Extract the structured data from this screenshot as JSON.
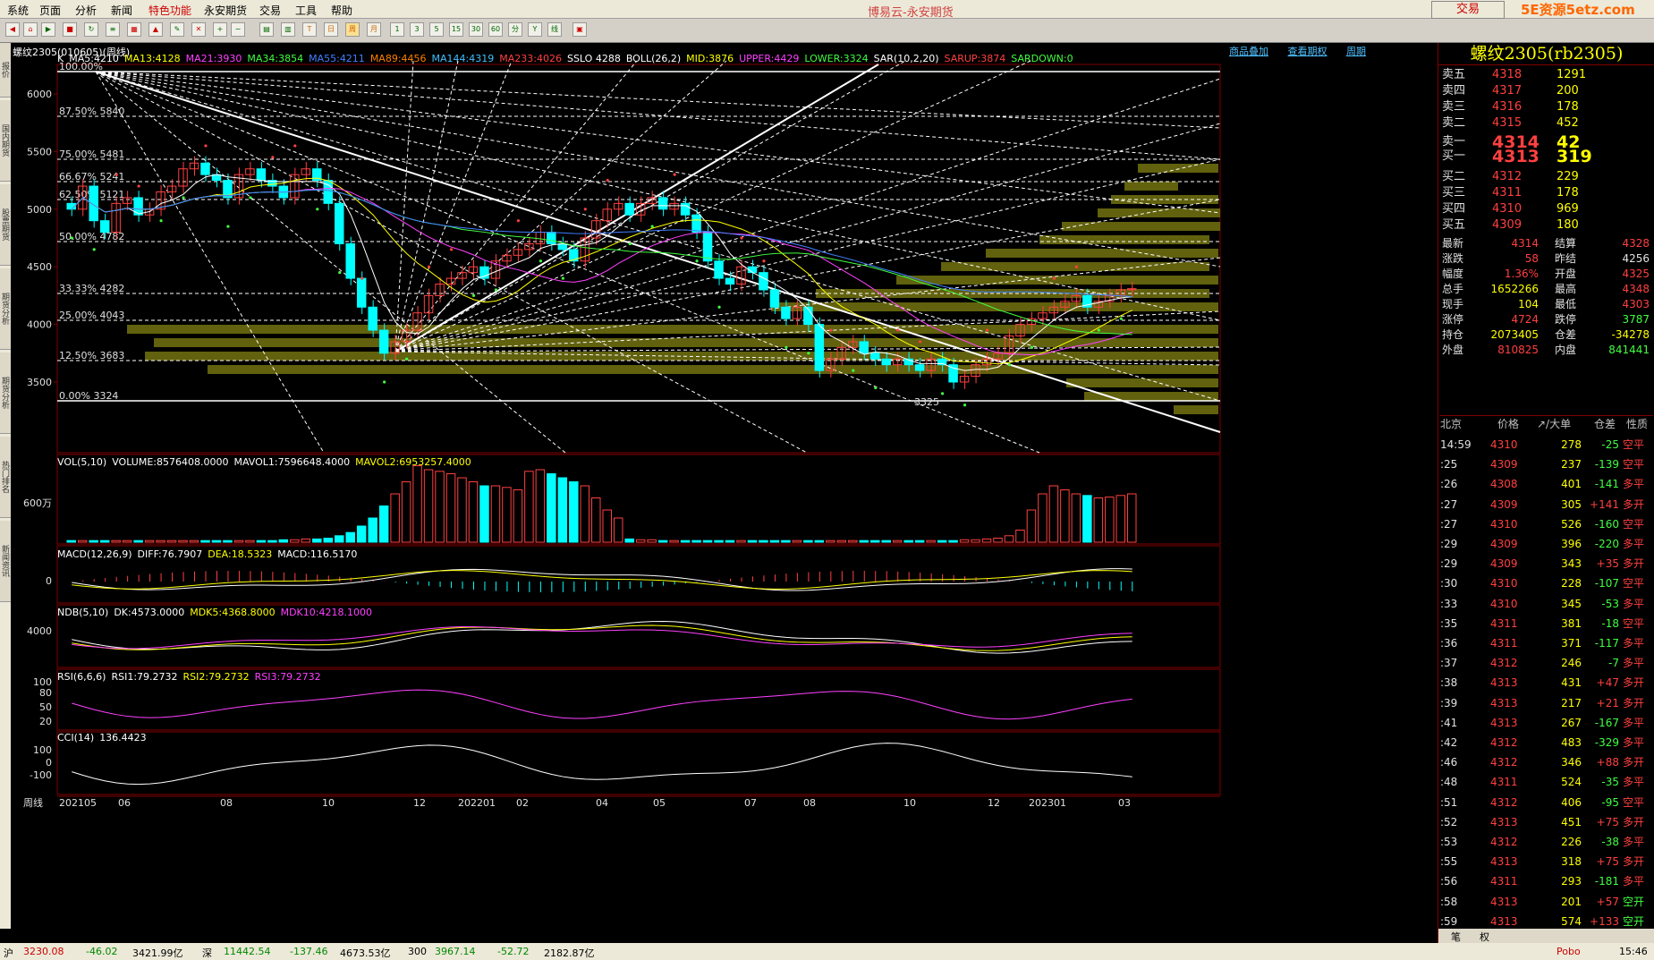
{
  "menu": {
    "items": [
      "系统",
      "页面",
      "分析",
      "新闻",
      "特色功能",
      "永安期货",
      "交易",
      "工具",
      "帮助"
    ],
    "app_title": "博易云-永安期货",
    "trade_button": "交易",
    "watermark": "5E资源5etz.com"
  },
  "toolbar": {
    "buttons": [
      "日",
      "周",
      "月",
      "1",
      "3",
      "5",
      "15",
      "30",
      "60",
      "分",
      "Y",
      "线"
    ]
  },
  "left_tabs": [
    "报价",
    "国内期货",
    "股票期货",
    "期货分析",
    "期货分析",
    "热门排名",
    "新闻资讯"
  ],
  "chart": {
    "header": "螺纹2305(010605)(周线)",
    "links": [
      "商品叠加",
      "查看期权",
      "周期"
    ],
    "main_indicators": [
      {
        "t": "K",
        "c": "#ffffff"
      },
      {
        "t": "MA5:4210",
        "c": "#ffffff"
      },
      {
        "t": "MA13:4128",
        "c": "#ffff00"
      },
      {
        "t": "MA21:3930",
        "c": "#ff40ff"
      },
      {
        "t": "MA34:3854",
        "c": "#40ff40"
      },
      {
        "t": "MA55:4211",
        "c": "#4080ff"
      },
      {
        "t": "MA89:4456",
        "c": "#ff8000"
      },
      {
        "t": "MA144:4319",
        "c": "#40c0ff"
      },
      {
        "t": "MA233:4026",
        "c": "#ff4040"
      },
      {
        "t": "SSLO 4288",
        "c": "#ffffff"
      },
      {
        "t": "BOLL(26,2)",
        "c": "#ffffff"
      },
      {
        "t": "MID:3876",
        "c": "#ffff00"
      },
      {
        "t": "UPPER:4429",
        "c": "#ff40ff"
      },
      {
        "t": "LOWER:3324",
        "c": "#40ff40"
      },
      {
        "t": "SAR(10,2,20)",
        "c": "#ffffff"
      },
      {
        "t": "SARUP:3874",
        "c": "#ff4040"
      },
      {
        "t": "SARDOWN:0",
        "c": "#40ff40"
      }
    ],
    "price_ticks": [
      "6000",
      "5500",
      "5000",
      "4500",
      "4000",
      "3500"
    ],
    "fib_levels": [
      "100.00%",
      "87.50%  5840",
      "75.00%  5481",
      "66.67%  5241",
      "62.50%  5121",
      "50.00%  4782",
      "33.33%  4282",
      "25.00%  4043",
      "12.50%  3683",
      "0.00%  3324"
    ],
    "low_label": "3325",
    "vol_indicators": [
      {
        "t": "VOL(5,10)",
        "c": "#ffffff"
      },
      {
        "t": "VOLUME:8576408.0000",
        "c": "#ffffff"
      },
      {
        "t": "MAVOL1:7596648.4000",
        "c": "#ffffff"
      },
      {
        "t": "MAVOL2:6953257.4000",
        "c": "#ffff00"
      }
    ],
    "vol_tick": "600万",
    "macd_indicators": [
      {
        "t": "MACD(12,26,9)",
        "c": "#ffffff"
      },
      {
        "t": "DIFF:76.7907",
        "c": "#ffffff"
      },
      {
        "t": "DEA:18.5323",
        "c": "#ffff00"
      },
      {
        "t": "MACD:116.5170",
        "c": "#ffffff"
      }
    ],
    "macd_tick": "0",
    "ndb_indicators": [
      {
        "t": "NDB(5,10)",
        "c": "#ffffff"
      },
      {
        "t": "DK:4573.0000",
        "c": "#ffffff"
      },
      {
        "t": "MDK5:4368.8000",
        "c": "#ffff00"
      },
      {
        "t": "MDK10:4218.1000",
        "c": "#ff40ff"
      }
    ],
    "ndb_tick": "4000",
    "rsi_indicators": [
      {
        "t": "RSI(6,6,6)",
        "c": "#ffffff"
      },
      {
        "t": "RSI1:79.2732",
        "c": "#ffffff"
      },
      {
        "t": "RSI2:79.2732",
        "c": "#ffff00"
      },
      {
        "t": "RSI3:79.2732",
        "c": "#ff40ff"
      }
    ],
    "rsi_ticks": [
      "100",
      "80",
      "50",
      "20"
    ],
    "cci_indicators": [
      {
        "t": "CCI(14)",
        "c": "#ffffff"
      },
      {
        "t": "136.4423",
        "c": "#ffffff"
      }
    ],
    "cci_ticks": [
      "100",
      "0",
      "-100"
    ],
    "period_label": "周线",
    "date_labels": [
      "202105",
      "06",
      "08",
      "10",
      "12",
      "202201",
      "02",
      "04",
      "05",
      "07",
      "08",
      "10",
      "12",
      "202301",
      "03"
    ]
  },
  "quote": {
    "title": "螺纹2305(rb2305)",
    "asks": [
      {
        "l": "卖五",
        "p": "4318",
        "v": "1291"
      },
      {
        "l": "卖四",
        "p": "4317",
        "v": "200"
      },
      {
        "l": "卖三",
        "p": "4316",
        "v": "178"
      },
      {
        "l": "卖二",
        "p": "4315",
        "v": "452"
      },
      {
        "l": "卖一",
        "p": "4314",
        "v": "42"
      }
    ],
    "bids": [
      {
        "l": "买一",
        "p": "4313",
        "v": "319"
      },
      {
        "l": "买二",
        "p": "4312",
        "v": "229"
      },
      {
        "l": "买三",
        "p": "4311",
        "v": "178"
      },
      {
        "l": "买四",
        "p": "4310",
        "v": "969"
      },
      {
        "l": "买五",
        "p": "4309",
        "v": "180"
      }
    ],
    "stats": [
      {
        "a": "最新",
        "b": "4314",
        "bc": "#ff4040",
        "c": "结算",
        "d": "4328",
        "dc": "#ff4040"
      },
      {
        "a": "涨跌",
        "b": "58",
        "bc": "#ff4040",
        "c": "昨结",
        "d": "4256",
        "dc": "#e0e0e0"
      },
      {
        "a": "幅度",
        "b": "1.36%",
        "bc": "#ff4040",
        "c": "开盘",
        "d": "4325",
        "dc": "#ff4040"
      },
      {
        "a": "总手",
        "b": "1652266",
        "bc": "#ffff00",
        "c": "最高",
        "d": "4348",
        "dc": "#ff4040"
      },
      {
        "a": "现手",
        "b": "104",
        "bc": "#ffff00",
        "c": "最低",
        "d": "4303",
        "dc": "#ff4040"
      },
      {
        "a": "涨停",
        "b": "4724",
        "bc": "#ff4040",
        "c": "跌停",
        "d": "3787",
        "dc": "#40ff40"
      },
      {
        "a": "持仓",
        "b": "2073405",
        "bc": "#ffff00",
        "c": "仓差",
        "d": "-34278",
        "dc": "#ffff00"
      },
      {
        "a": "外盘",
        "b": "810825",
        "bc": "#ff4040",
        "c": "内盘",
        "d": "841441",
        "dc": "#40ff40"
      }
    ],
    "tick_header": {
      "loc": "北京",
      "price": "价格",
      "vol": "↗/大单",
      "oi": "仓差",
      "type": "性质"
    },
    "ticks": [
      {
        "t": "14:59",
        "p": "4310",
        "v": "278",
        "o": "-25",
        "y": "空平"
      },
      {
        "t": ":25",
        "p": "4309",
        "v": "237",
        "o": "-139",
        "y": "空平"
      },
      {
        "t": ":26",
        "p": "4308",
        "v": "401",
        "o": "-141",
        "y": "多平"
      },
      {
        "t": ":27",
        "p": "4309",
        "v": "305",
        "o": "+141",
        "y": "多开"
      },
      {
        "t": ":27",
        "p": "4310",
        "v": "526",
        "o": "-160",
        "y": "空平"
      },
      {
        "t": ":29",
        "p": "4309",
        "v": "396",
        "o": "-220",
        "y": "多平"
      },
      {
        "t": ":29",
        "p": "4309",
        "v": "343",
        "o": "+35",
        "y": "多开"
      },
      {
        "t": ":30",
        "p": "4310",
        "v": "228",
        "o": "-107",
        "y": "空平"
      },
      {
        "t": ":33",
        "p": "4310",
        "v": "345",
        "o": "-53",
        "y": "多平"
      },
      {
        "t": ":35",
        "p": "4311",
        "v": "381",
        "o": "-18",
        "y": "空平"
      },
      {
        "t": ":36",
        "p": "4311",
        "v": "371",
        "o": "-117",
        "y": "多平"
      },
      {
        "t": ":37",
        "p": "4312",
        "v": "246",
        "o": "-7",
        "y": "多平"
      },
      {
        "t": ":38",
        "p": "4313",
        "v": "431",
        "o": "+47",
        "y": "多开"
      },
      {
        "t": ":39",
        "p": "4313",
        "v": "217",
        "o": "+21",
        "y": "多开"
      },
      {
        "t": ":41",
        "p": "4313",
        "v": "267",
        "o": "-167",
        "y": "多平"
      },
      {
        "t": ":42",
        "p": "4312",
        "v": "483",
        "o": "-329",
        "y": "多平"
      },
      {
        "t": ":46",
        "p": "4312",
        "v": "346",
        "o": "+88",
        "y": "多开"
      },
      {
        "t": ":48",
        "p": "4311",
        "v": "524",
        "o": "-35",
        "y": "多平"
      },
      {
        "t": ":51",
        "p": "4312",
        "v": "406",
        "o": "-95",
        "y": "空平"
      },
      {
        "t": ":52",
        "p": "4313",
        "v": "451",
        "o": "+75",
        "y": "多开"
      },
      {
        "t": ":53",
        "p": "4312",
        "v": "226",
        "o": "-38",
        "y": "多平"
      },
      {
        "t": ":55",
        "p": "4313",
        "v": "318",
        "o": "+75",
        "y": "多开"
      },
      {
        "t": ":56",
        "p": "4311",
        "v": "293",
        "o": "-181",
        "y": "多平"
      },
      {
        "t": ":58",
        "p": "4313",
        "v": "201",
        "o": "+57",
        "y": "空开"
      },
      {
        "t": ":59",
        "p": "4313",
        "v": "574",
        "o": "+133",
        "y": "空开"
      }
    ],
    "bottom_tabs": [
      "笔",
      "权"
    ]
  },
  "status": {
    "items": [
      "沪",
      "3230.08",
      "-46.02",
      "3421.99亿",
      "深",
      "11442.54",
      "-137.46",
      "4673.53亿",
      "300",
      "3967.14",
      "-52.72",
      "2182.87亿",
      "Pobo",
      "15:46"
    ]
  },
  "colors": {
    "up": "#ff4040",
    "down": "#00ffff",
    "panel_border": "#800000"
  }
}
